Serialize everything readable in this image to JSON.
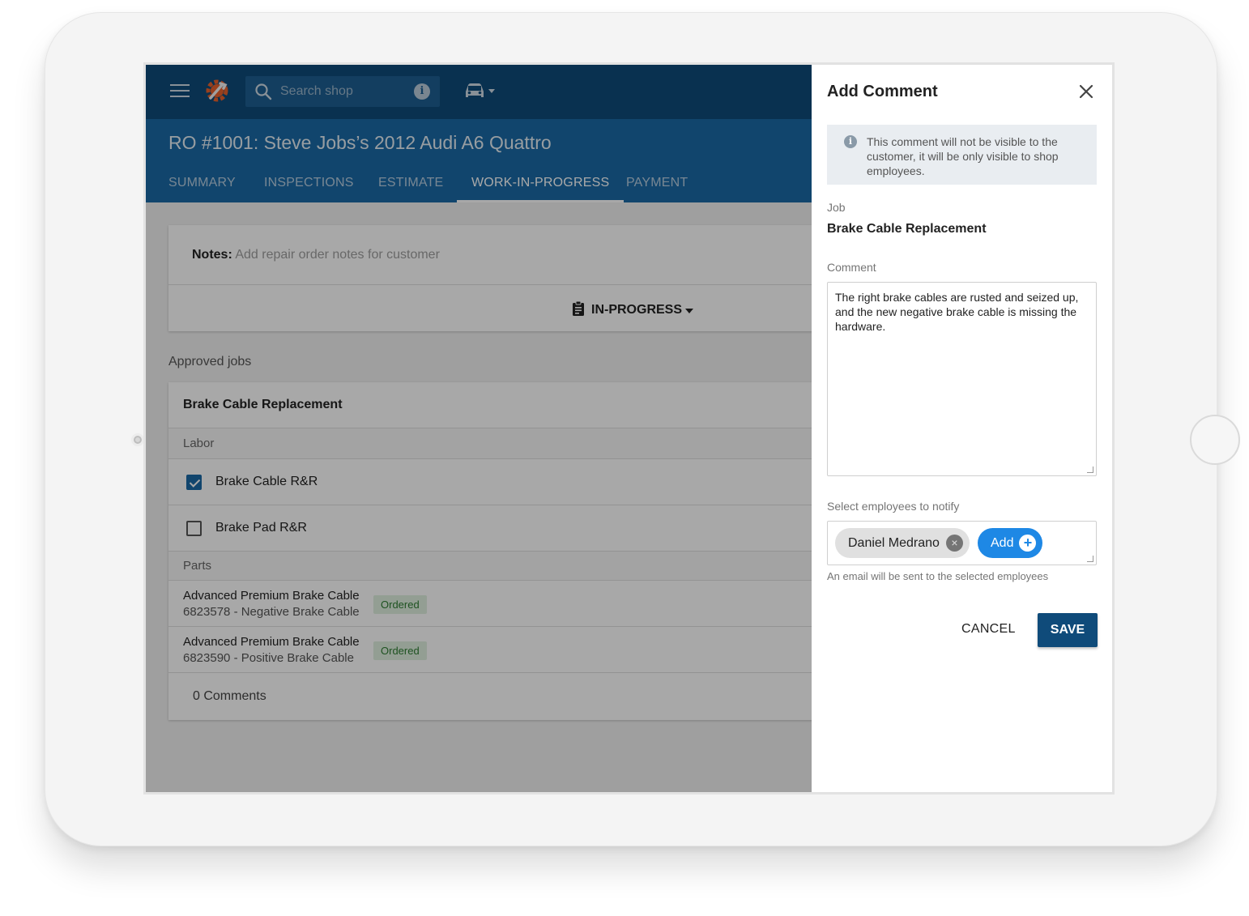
{
  "topbar": {
    "search_placeholder": "Search shop",
    "info_glyph": "i",
    "icons": [
      "menu-icon",
      "logo-gear-wrench-icon",
      "search-icon",
      "info-icon",
      "car-icon",
      "caret-down-icon"
    ]
  },
  "repair_order": {
    "title": "RO #1001: Steve Jobs’s 2012 Audi A6 Quattro",
    "tabs": [
      {
        "label": "SUMMARY",
        "active": false
      },
      {
        "label": "INSPECTIONS",
        "active": false
      },
      {
        "label": "ESTIMATE",
        "active": false
      },
      {
        "label": "WORK-IN-PROGRESS",
        "active": true
      },
      {
        "label": "PAYMENT",
        "active": false
      }
    ]
  },
  "notes": {
    "label": "Notes:",
    "placeholder": "Add repair order notes for customer"
  },
  "status": {
    "label": "IN-PROGRESS"
  },
  "approved_jobs": {
    "heading": "Approved jobs",
    "job": {
      "title": "Brake Cable Replacement",
      "labor_heading": "Labor",
      "labor": [
        {
          "label": "Brake Cable R&R",
          "checked": true
        },
        {
          "label": "Brake Pad R&R",
          "checked": false
        }
      ],
      "parts_heading": "Parts",
      "parts": [
        {
          "name": "Advanced Premium Brake Cable",
          "number": "6823578 - Negative Brake Cable",
          "status": "Ordered"
        },
        {
          "name": "Advanced Premium Brake Cable",
          "number": "6823590 - Positive Brake Cable",
          "status": "Ordered"
        }
      ],
      "comments": "0 Comments"
    }
  },
  "panel": {
    "title": "Add Comment",
    "info_glyph": "i",
    "info_text": "This comment will not be visible to the customer, it will be only visible to shop employees.",
    "job_label": "Job",
    "job_value": "Brake Cable Replacement",
    "comment_label": "Comment",
    "comment_value": "The right brake cables are rusted and seized up, and the new negative brake cable is missing the hardware.",
    "employees_label": "Select employees to notify",
    "employee_chip": "Daniel Medrano",
    "chip_remove_glyph": "×",
    "add_label": "Add",
    "add_glyph": "+",
    "hint": "An email will be sent to the selected employees",
    "cancel_label": "CANCEL",
    "save_label": "SAVE"
  },
  "colors": {
    "topbar": "#0f4b7a",
    "header": "#1b6aa6",
    "accent_blue": "#1e88e5",
    "badge_green": "#2e7d32"
  }
}
